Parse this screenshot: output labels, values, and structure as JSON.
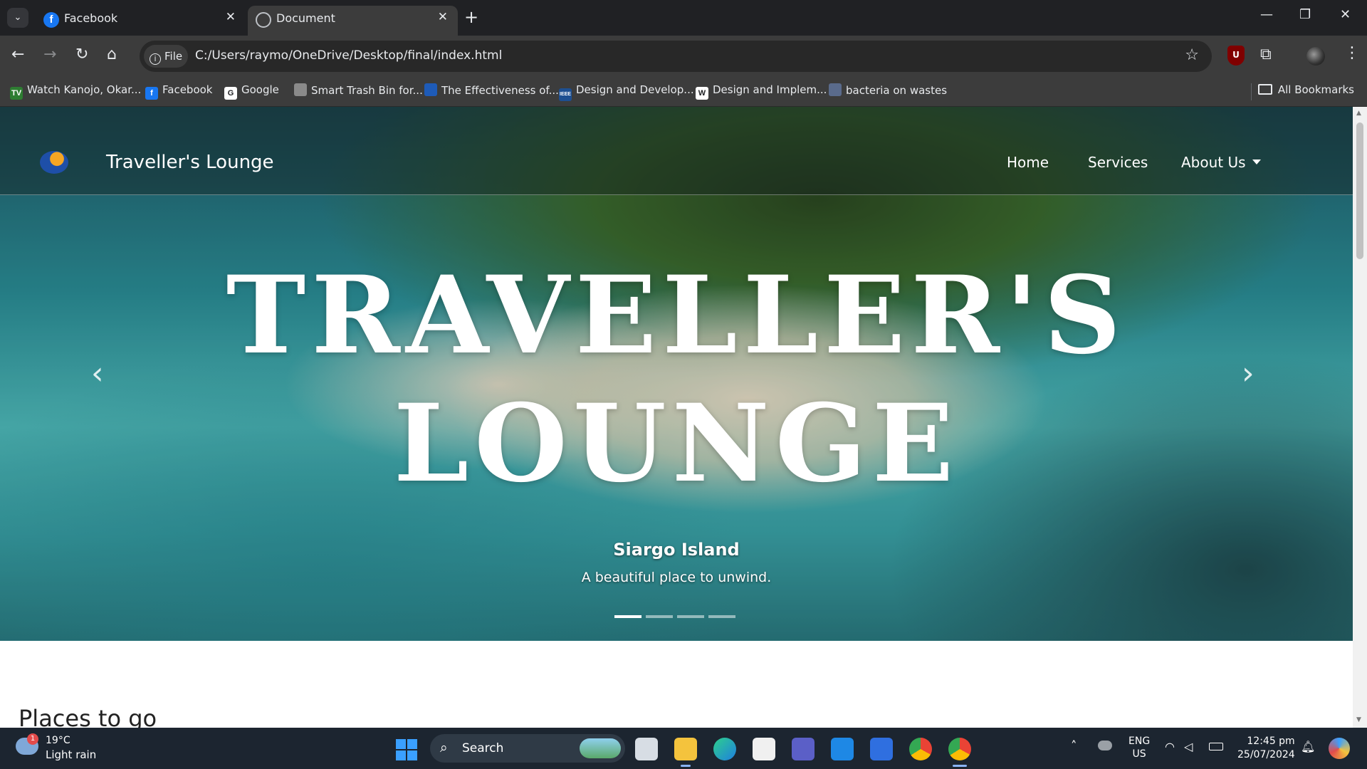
{
  "tabs": [
    {
      "title": "Facebook",
      "icon": "facebook-icon",
      "active": false
    },
    {
      "title": "Document",
      "icon": "globe-icon",
      "active": true
    }
  ],
  "toolbar": {
    "file_chip": "File",
    "url": "C:/Users/raymo/OneDrive/Desktop/final/index.html"
  },
  "bookmarks": [
    {
      "label": "Watch Kanojo, Okar...",
      "icon": "tv-icon",
      "color": "#2e7d32",
      "glyph": "TV"
    },
    {
      "label": "Facebook",
      "icon": "facebook-icon",
      "color": "#1877f2",
      "glyph": "f"
    },
    {
      "label": "Google",
      "icon": "google-icon",
      "color": "#ffffff",
      "glyph": "G"
    },
    {
      "label": "Smart Trash Bin for...",
      "icon": "document-icon",
      "color": "#8a8a8a",
      "glyph": ""
    },
    {
      "label": "The Effectiveness of...",
      "icon": "site-icon",
      "color": "#1e5bb8",
      "glyph": ""
    },
    {
      "label": "Design and Develop...",
      "icon": "ieee-icon",
      "color": "#1d4f91",
      "glyph": "IEEE"
    },
    {
      "label": "Design and Implem...",
      "icon": "wikipedia-icon",
      "color": "#ffffff",
      "glyph": "W"
    },
    {
      "label": "bacteria on wastes",
      "icon": "site-icon",
      "color": "#5a6b8c",
      "glyph": ""
    }
  ],
  "all_bookmarks": "All Bookmarks",
  "site": {
    "brand": "Traveller's Lounge",
    "nav": [
      {
        "label": "Home"
      },
      {
        "label": "Services"
      },
      {
        "label": "About Us",
        "dropdown": true
      }
    ],
    "hero_line1": "TRAVELLER'S",
    "hero_line2": "LOUNGE",
    "slide_title": "Siargo Island",
    "slide_caption": "A beautiful place to unwind.",
    "slide_count": 4,
    "active_slide": 1,
    "section_title": "Places to go"
  },
  "taskbar": {
    "weather_temp": "19°C",
    "weather_desc": "Light rain",
    "weather_badge": "1",
    "search_label": "Search",
    "lang_line1": "ENG",
    "lang_line2": "US",
    "time": "12:45 pm",
    "date": "25/07/2024",
    "apps": [
      "file-explorer-icon",
      "edge-icon",
      "store-icon",
      "teams-icon",
      "vscode-icon",
      "app-icon",
      "chrome-icon",
      "chrome-active-icon"
    ]
  },
  "colors": {
    "accent": "#8ab4f8",
    "taskbar": "#1c2530",
    "chrome_dark": "#202124"
  }
}
